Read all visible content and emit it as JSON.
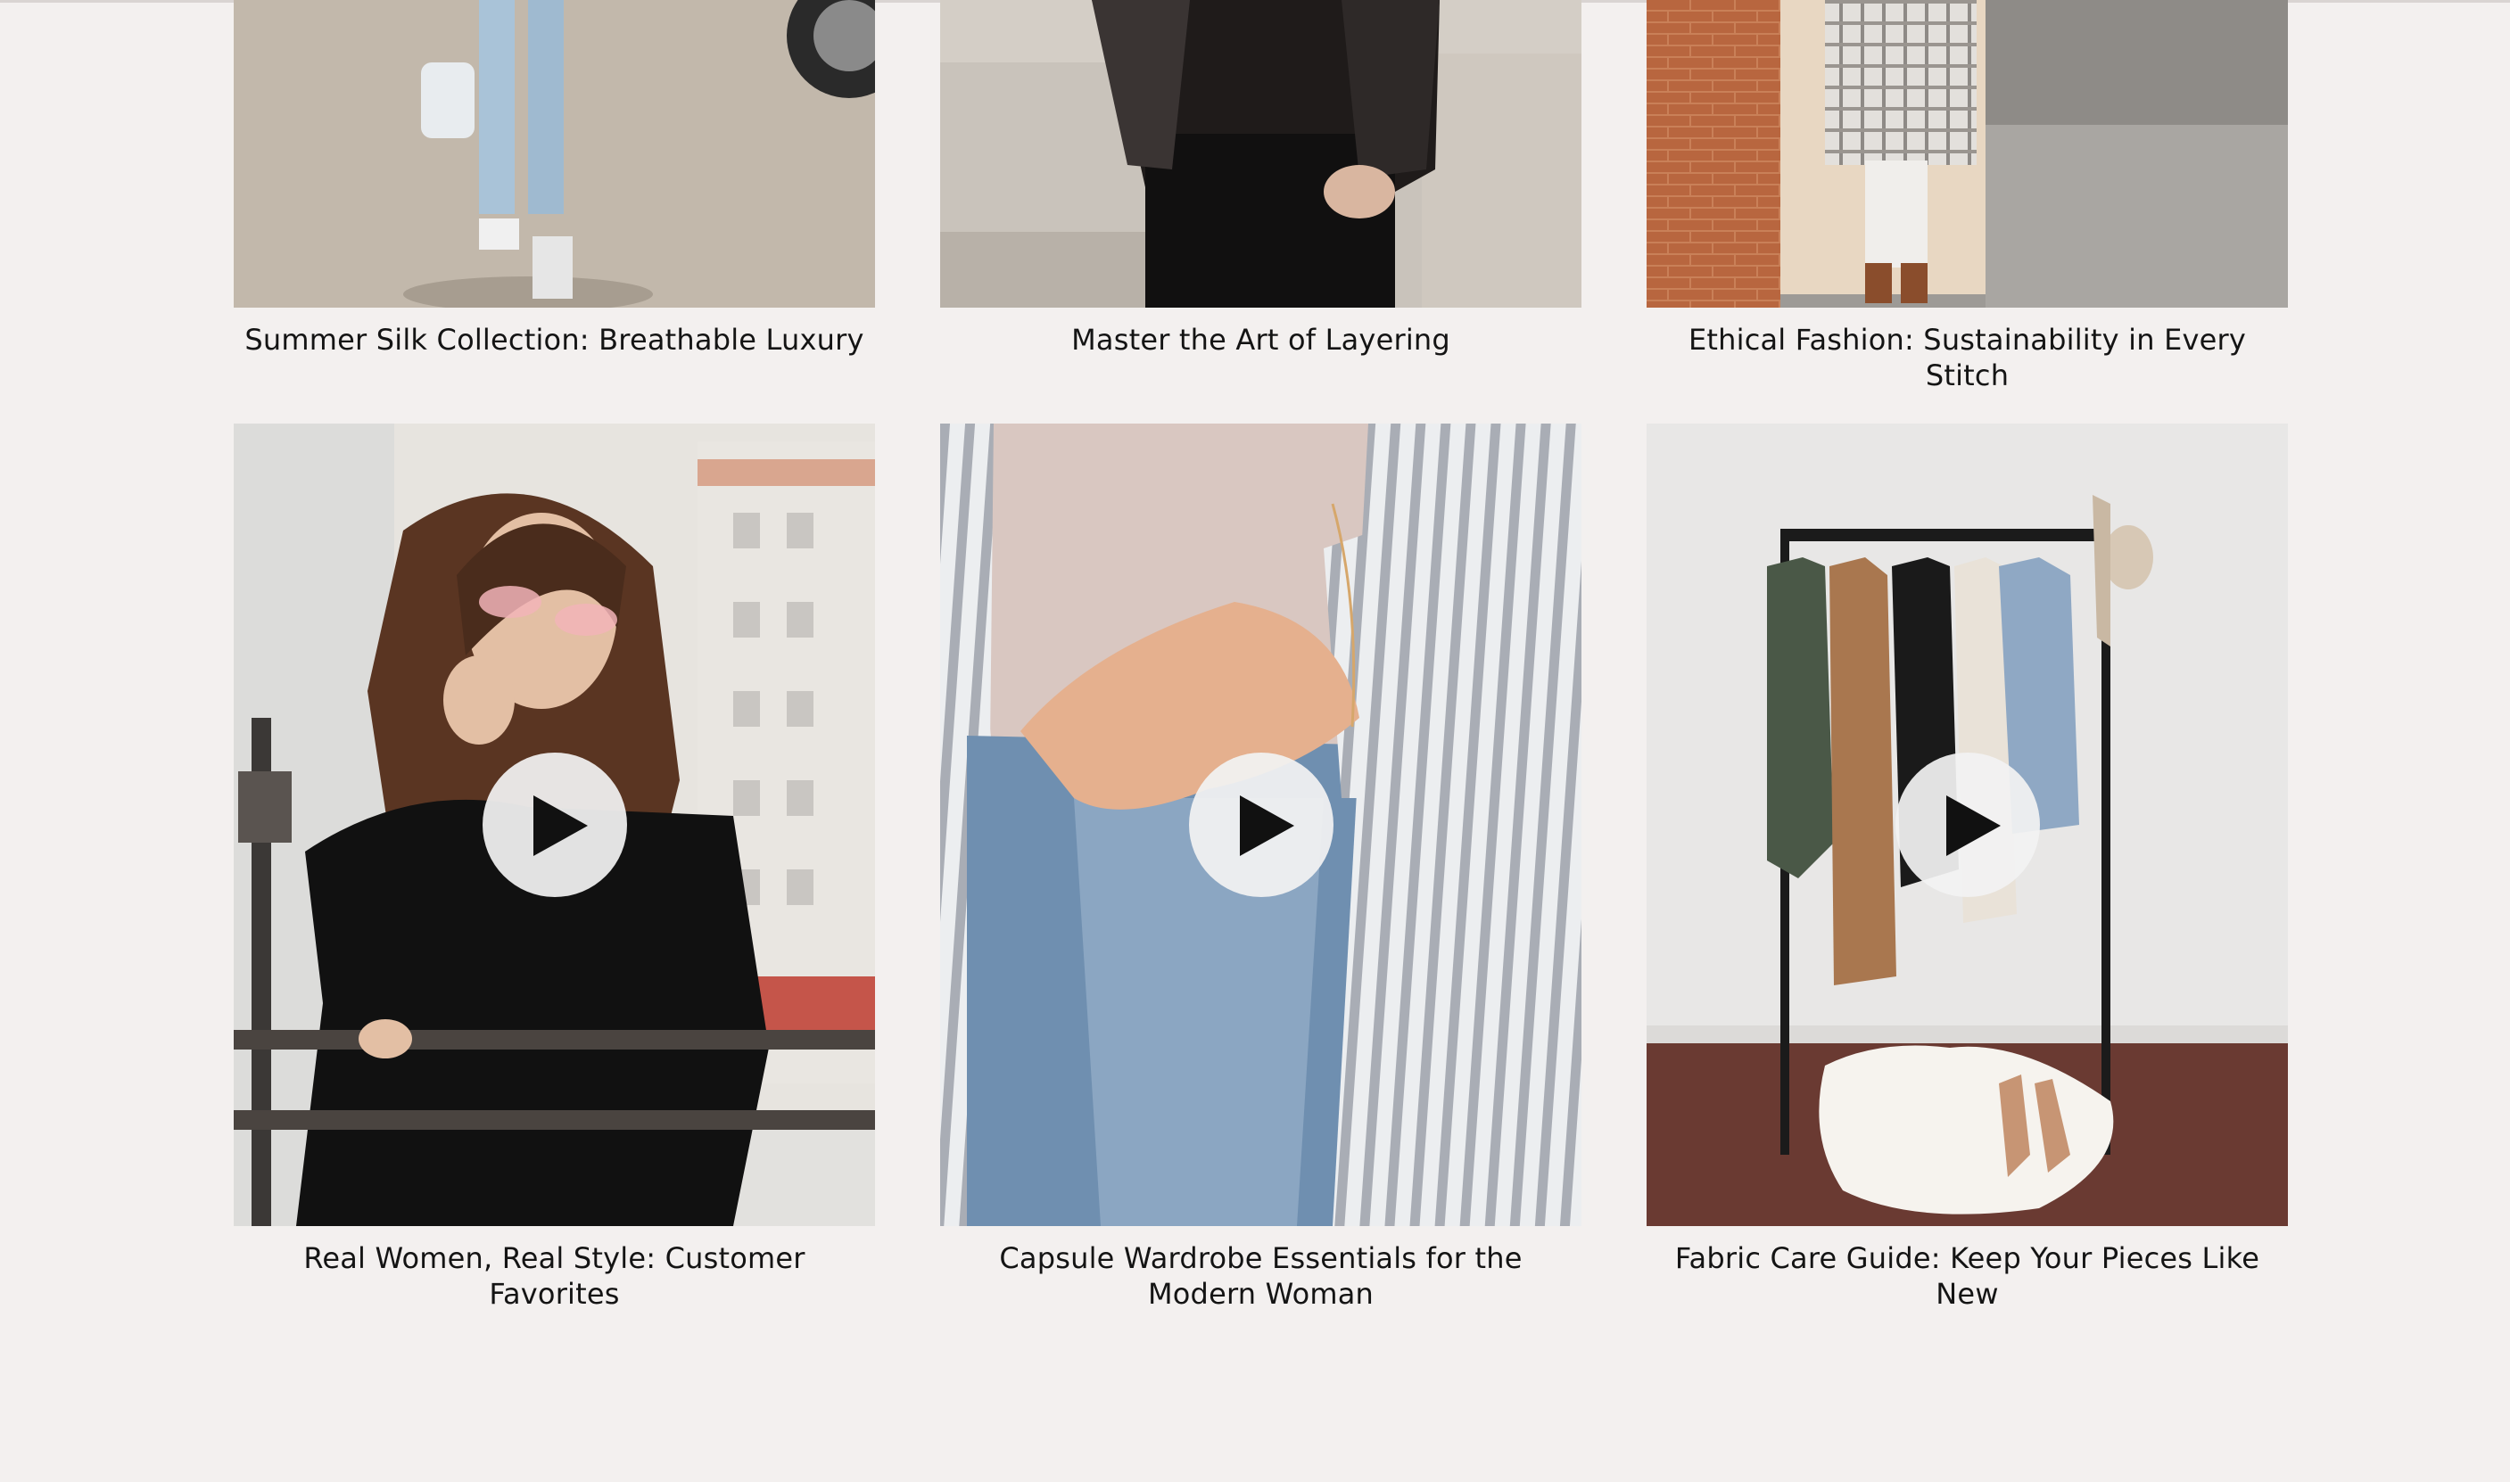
{
  "colors": {
    "page_background": "#f3f0ef",
    "caption_text": "#141414",
    "play_button": "#f2f2f2",
    "play_glyph": "#111111"
  },
  "row_top": [
    {
      "caption": "Summer Silk Collection: Breathable Luxury",
      "image_icon": "photo-street-walk"
    },
    {
      "caption": "Master the Art of Layering",
      "image_icon": "photo-leather-jacket"
    },
    {
      "caption": "Ethical Fashion: Sustainability in Every Stitch",
      "image_icon": "photo-plaid-coat"
    }
  ],
  "row_videos": [
    {
      "caption": "Real Women, Real Style: Customer Favorites",
      "image_icon": "photo-woman-sunglasses",
      "play_icon": "play-icon"
    },
    {
      "caption": "Capsule Wardrobe Essentials for the Modern Woman",
      "image_icon": "photo-striped-shirt-jeans",
      "play_icon": "play-icon"
    },
    {
      "caption": "Fabric Care Guide: Keep Your Pieces Like New",
      "image_icon": "photo-clothing-rack",
      "play_icon": "play-icon"
    }
  ]
}
